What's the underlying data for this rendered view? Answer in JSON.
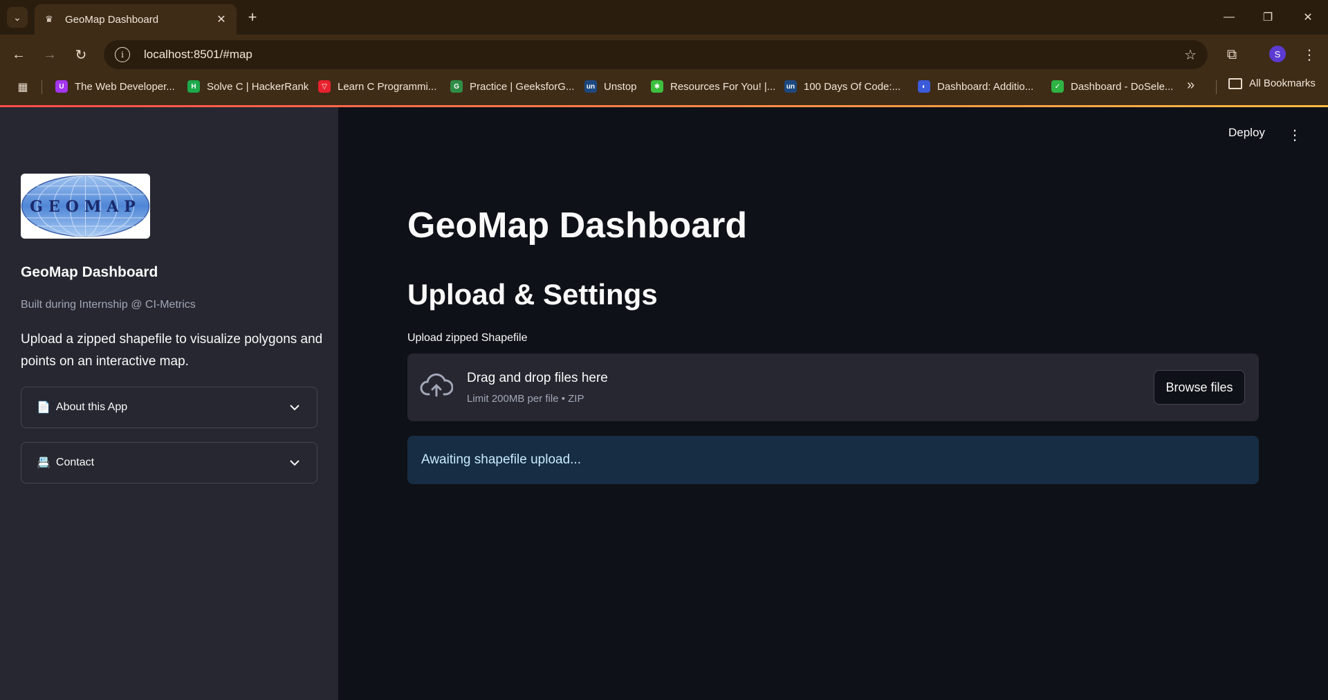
{
  "browser": {
    "tab_title": "GeoMap Dashboard",
    "url": "localhost:8501/#map",
    "profile_initial": "S",
    "bookmarks": [
      {
        "label": "The Web Developer...",
        "icon_color": "#a435f0",
        "icon_text": "U"
      },
      {
        "label": "Solve C | HackerRank",
        "icon_color": "#1ba94c",
        "icon_text": "H"
      },
      {
        "label": "Learn C Programmi...",
        "icon_color": "#e8212e",
        "icon_text": "▽"
      },
      {
        "label": "Practice | GeeksforG...",
        "icon_color": "#2f8d46",
        "icon_text": "G"
      },
      {
        "label": "Unstop",
        "icon_color": "#1c4980",
        "icon_text": "un"
      },
      {
        "label": "Resources For You! |...",
        "icon_color": "#3fbf3f",
        "icon_text": "✱"
      },
      {
        "label": "100 Days Of Code:...",
        "icon_color": "#1c4980",
        "icon_text": "un"
      },
      {
        "label": "Dashboard: Additio...",
        "icon_color": "#3b5bdb",
        "icon_text": "◐"
      },
      {
        "label": "Dashboard - DoSele...",
        "icon_color": "#2fb344",
        "icon_text": "✓"
      }
    ],
    "all_bookmarks": "All Bookmarks"
  },
  "sidebar": {
    "logo_text": "GEOMAP",
    "title": "GeoMap Dashboard",
    "caption": "Built during Internship @ CI-Metrics",
    "description": "Upload a zipped shapefile to visualize polygons and points on an interactive map.",
    "expanders": [
      {
        "emoji": "📄",
        "label": "About this App"
      },
      {
        "emoji": "📇",
        "label": "Contact"
      }
    ]
  },
  "header": {
    "deploy_label": "Deploy"
  },
  "main": {
    "title": "GeoMap Dashboard",
    "subtitle": "Upload & Settings",
    "uploader": {
      "label": "Upload zipped Shapefile",
      "drop_text": "Drag and drop files here",
      "limit_text": "Limit 200MB per file • ZIP",
      "browse_label": "Browse files"
    },
    "info_message": "Awaiting shapefile upload..."
  },
  "colors": {
    "accent_gradient_start": "#ff4b4b",
    "accent_gradient_end": "#ffbd45",
    "info_bg": "#172d43",
    "info_text": "#c7ebff",
    "sidebar_bg": "#262730",
    "main_bg": "#0e1117"
  }
}
